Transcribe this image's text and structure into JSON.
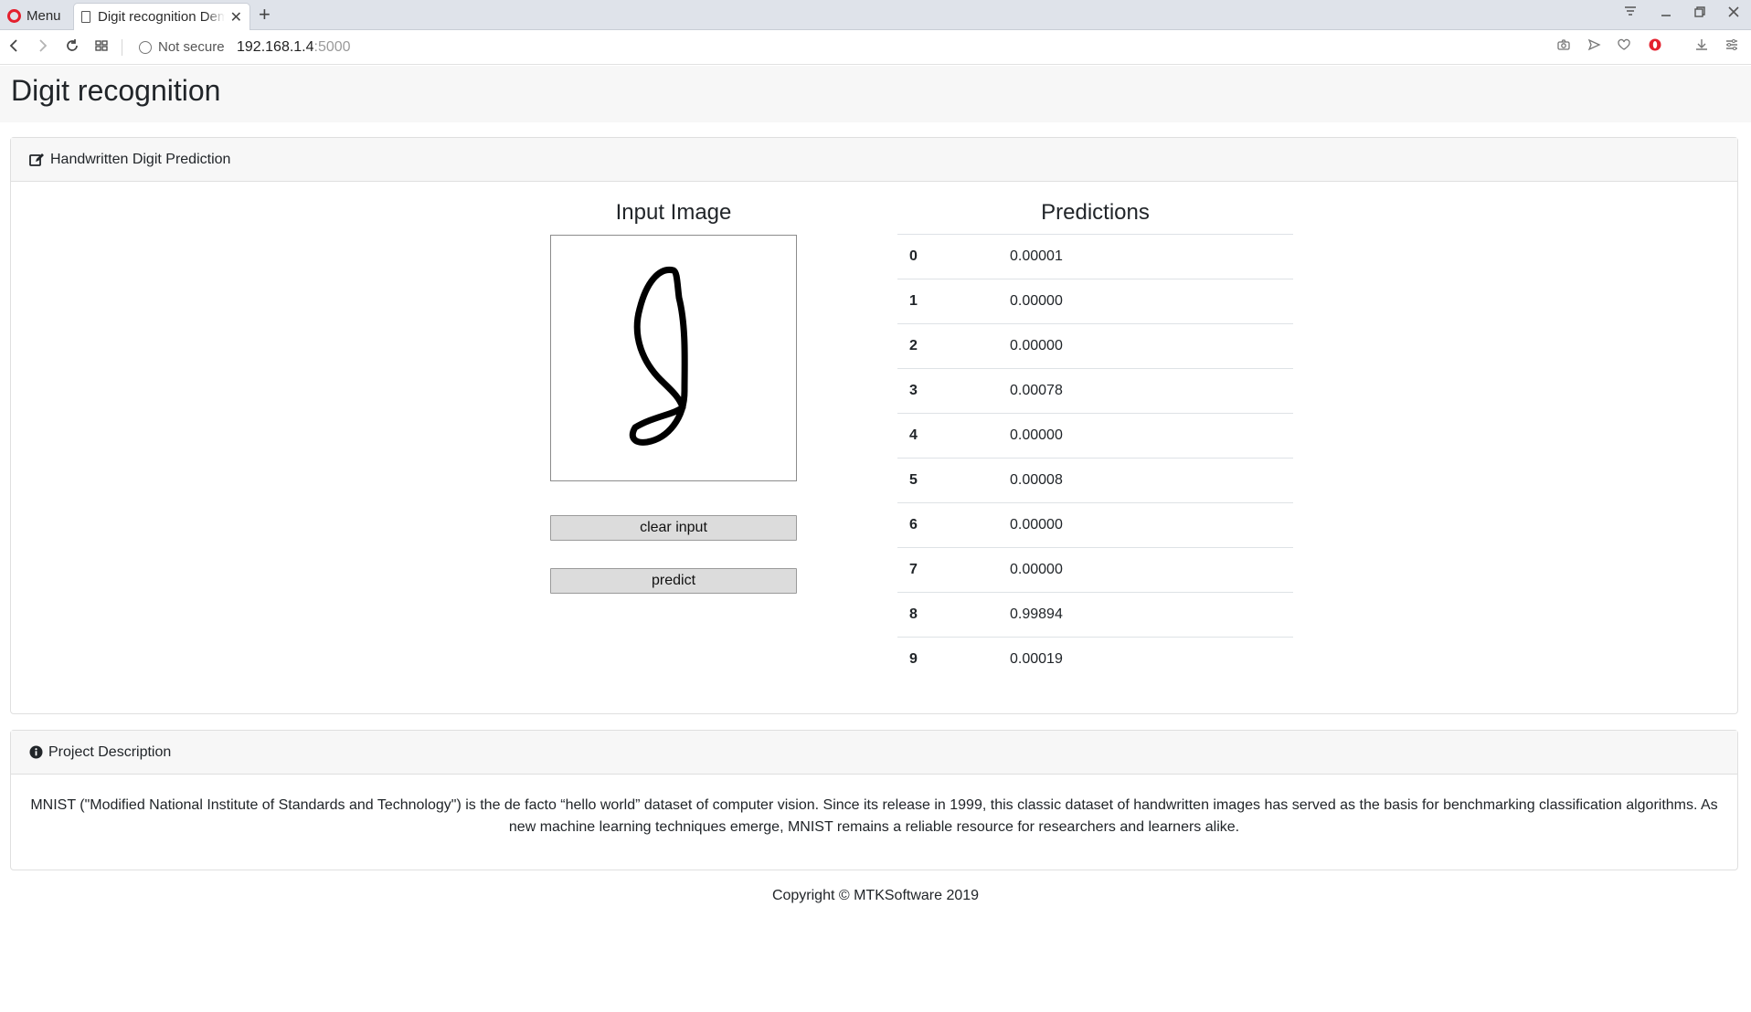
{
  "browser": {
    "menu_label": "Menu",
    "tab_title": "Digit recognition Demo",
    "new_tab": "+",
    "security_label": "Not secure",
    "url_host": "192.168.1.4",
    "url_port": ":5000"
  },
  "page": {
    "title": "Digit recognition"
  },
  "prediction_card": {
    "header": "Handwritten Digit Prediction",
    "input_title": "Input Image",
    "clear_label": "clear input",
    "predict_label": "predict",
    "predictions_title": "Predictions",
    "predictions": [
      {
        "digit": "0",
        "prob": "0.00001"
      },
      {
        "digit": "1",
        "prob": "0.00000"
      },
      {
        "digit": "2",
        "prob": "0.00000"
      },
      {
        "digit": "3",
        "prob": "0.00078"
      },
      {
        "digit": "4",
        "prob": "0.00000"
      },
      {
        "digit": "5",
        "prob": "0.00008"
      },
      {
        "digit": "6",
        "prob": "0.00000"
      },
      {
        "digit": "7",
        "prob": "0.00000"
      },
      {
        "digit": "8",
        "prob": "0.99894"
      },
      {
        "digit": "9",
        "prob": "0.00019"
      }
    ]
  },
  "description_card": {
    "header": "Project Description",
    "text": "MNIST (\"Modified National Institute of Standards and Technology\") is the de facto “hello world” dataset of computer vision. Since its release in 1999, this classic dataset of handwritten images has served as the basis for benchmarking classification algorithms. As new machine learning techniques emerge, MNIST remains a reliable resource for researchers and learners alike."
  },
  "footer": {
    "copyright": "Copyright © MTKSoftware 2019"
  },
  "icons": {
    "header_edit": "edit-icon",
    "header_info": "info-circle-icon"
  },
  "colors": {
    "opera_red": "#e4202e",
    "card_header_bg": "#f7f7f7",
    "button_bg": "#dcdcdc"
  }
}
